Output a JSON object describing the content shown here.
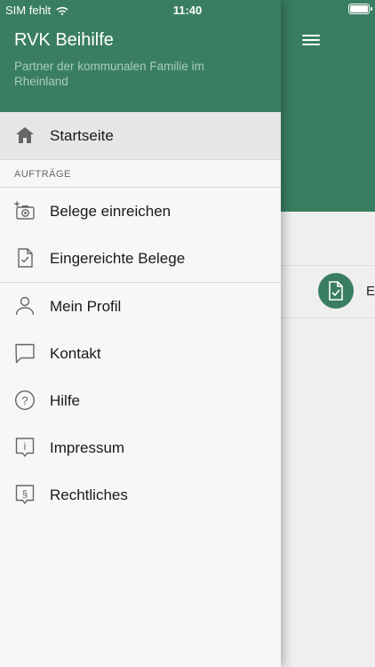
{
  "status_bar": {
    "carrier": "SIM fehlt",
    "time": "11:40"
  },
  "drawer": {
    "title": "RVK Beihilfe",
    "subtitle": "Partner der kommunalen Familie im Rheinland",
    "items": [
      {
        "label": "Startseite",
        "icon": "home-icon"
      },
      {
        "section": "AUFTRÄGE"
      },
      {
        "label": "Belege einreichen",
        "icon": "add-photo-icon"
      },
      {
        "label": "Eingereichte Belege",
        "icon": "document-check-icon"
      },
      {
        "label": "Mein Profil",
        "icon": "person-icon"
      },
      {
        "label": "Kontakt",
        "icon": "chat-bubble-icon"
      },
      {
        "label": "Hilfe",
        "icon": "help-icon"
      },
      {
        "label": "Impressum",
        "icon": "info-icon"
      },
      {
        "label": "Rechtliches",
        "icon": "paragraph-icon"
      }
    ]
  },
  "background_list": {
    "row_text": "E"
  },
  "colors": {
    "primary": "#3a7e62",
    "subtitle": "#a8cdbb"
  }
}
